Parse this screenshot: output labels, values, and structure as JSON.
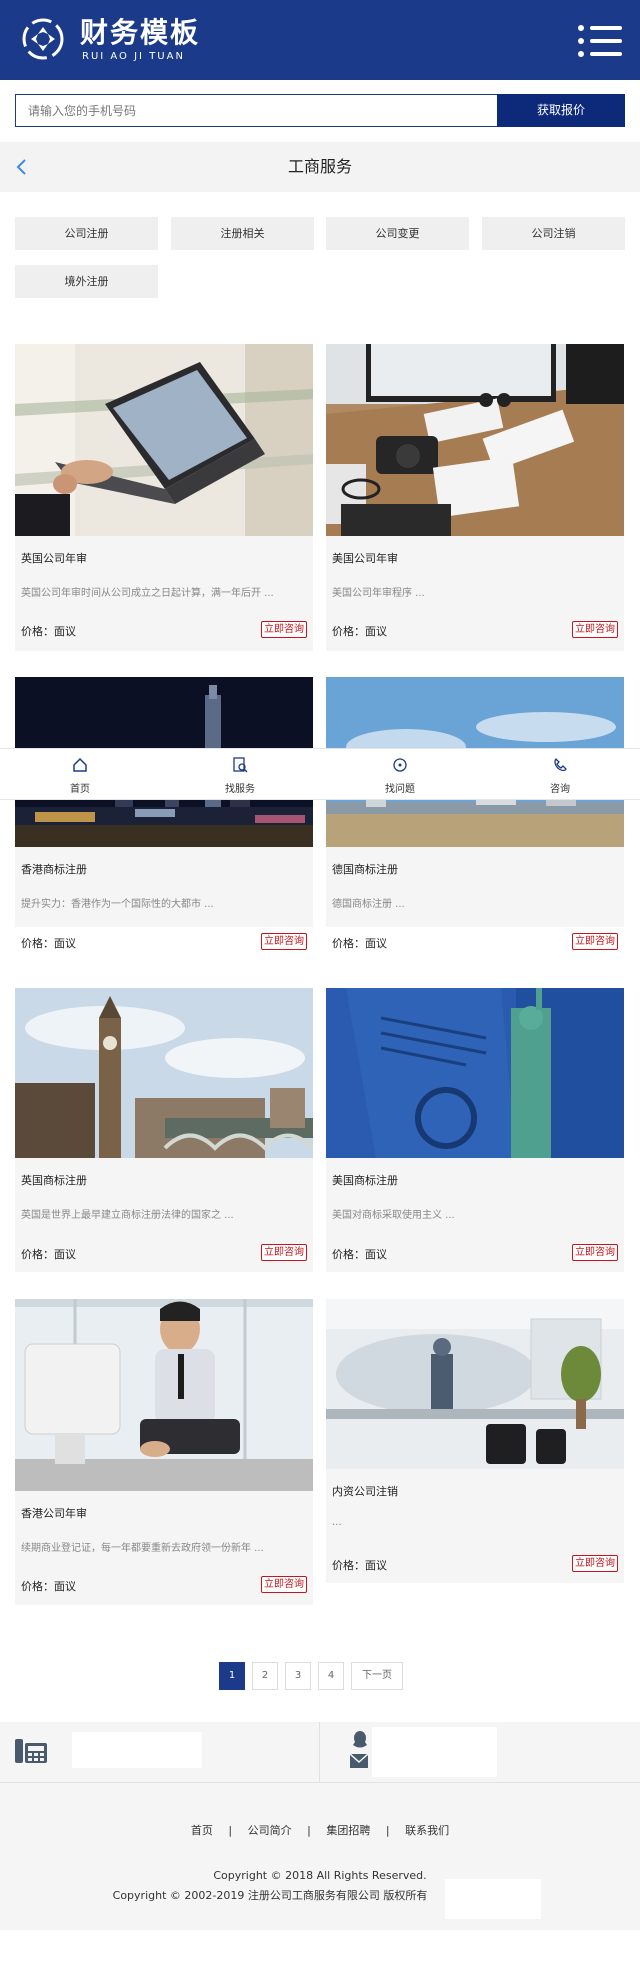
{
  "header": {
    "logo_title": "财务模板",
    "logo_subtitle": "RUI AO JI TUAN"
  },
  "phone_form": {
    "placeholder": "请输入您的手机号码",
    "submit_label": "获取报价"
  },
  "page_title": "工商服务",
  "categories": [
    "公司注册",
    "注册相关",
    "公司变更",
    "公司注销",
    "境外注册"
  ],
  "products": [
    {
      "title": "英国公司年审",
      "desc": "英国公司年审时间从公司成立之日起计算，满一年后开 ...",
      "price_label": "价格：面议",
      "consult_label": "立即咨询",
      "image": "laptop-office-photo"
    },
    {
      "title": "美国公司年审",
      "desc": "美国公司年审程序 ...",
      "price_label": "价格：面议",
      "consult_label": "立即咨询",
      "image": "desk-workspace-photo"
    },
    {
      "title": "香港商标注册",
      "desc": "提升实力：香港作为一个国际性的大都市 ...",
      "price_label": "价格：面议",
      "consult_label": "立即咨询",
      "image": "hongkong-skyline-photo"
    },
    {
      "title": "德国商标注册",
      "desc": "德国商标注册 ...",
      "price_label": "价格：面议",
      "consult_label": "立即咨询",
      "image": "harbor-city-photo"
    },
    {
      "title": "英国商标注册",
      "desc": "英国是世界上最早建立商标注册法律的国家之 ...",
      "price_label": "价格：面议",
      "consult_label": "立即咨询",
      "image": "big-ben-photo"
    },
    {
      "title": "美国商标注册",
      "desc": "美国对商标采取使用主义 ...",
      "price_label": "价格：面议",
      "consult_label": "立即咨询",
      "image": "liberty-document-photo"
    },
    {
      "title": "香港公司年审",
      "desc": "续期商业登记证，每一年都要重新去政府领一份新年 ...",
      "price_label": "价格：面议",
      "consult_label": "立即咨询",
      "image": "businessman-imac-photo"
    },
    {
      "title": "内资公司注销",
      "desc": "...",
      "price_label": "价格：面议",
      "consult_label": "立即咨询",
      "image": "office-world-map-photo"
    }
  ],
  "bottom_nav": [
    {
      "label": "首页",
      "icon": "home-icon"
    },
    {
      "label": "找服务",
      "icon": "search-document-icon"
    },
    {
      "label": "找问题",
      "icon": "target-icon"
    },
    {
      "label": "咨询",
      "icon": "phone-icon"
    }
  ],
  "pagination": {
    "pages": [
      "1",
      "2",
      "3",
      "4"
    ],
    "current": "1",
    "next_label": "下一页"
  },
  "footer": {
    "links": [
      "首页",
      "公司简介",
      "集团招聘",
      "联系我们"
    ],
    "separator": "|",
    "copyright_line1": "Copyright © 2018 All Rights Reserved.",
    "copyright_line2": "Copyright © 2002-2019 注册公司工商服务有限公司 版权所有"
  },
  "colors": {
    "brand": "#1b3a8a",
    "accent_red": "#c4161c",
    "page_bg": "#ffffff"
  }
}
